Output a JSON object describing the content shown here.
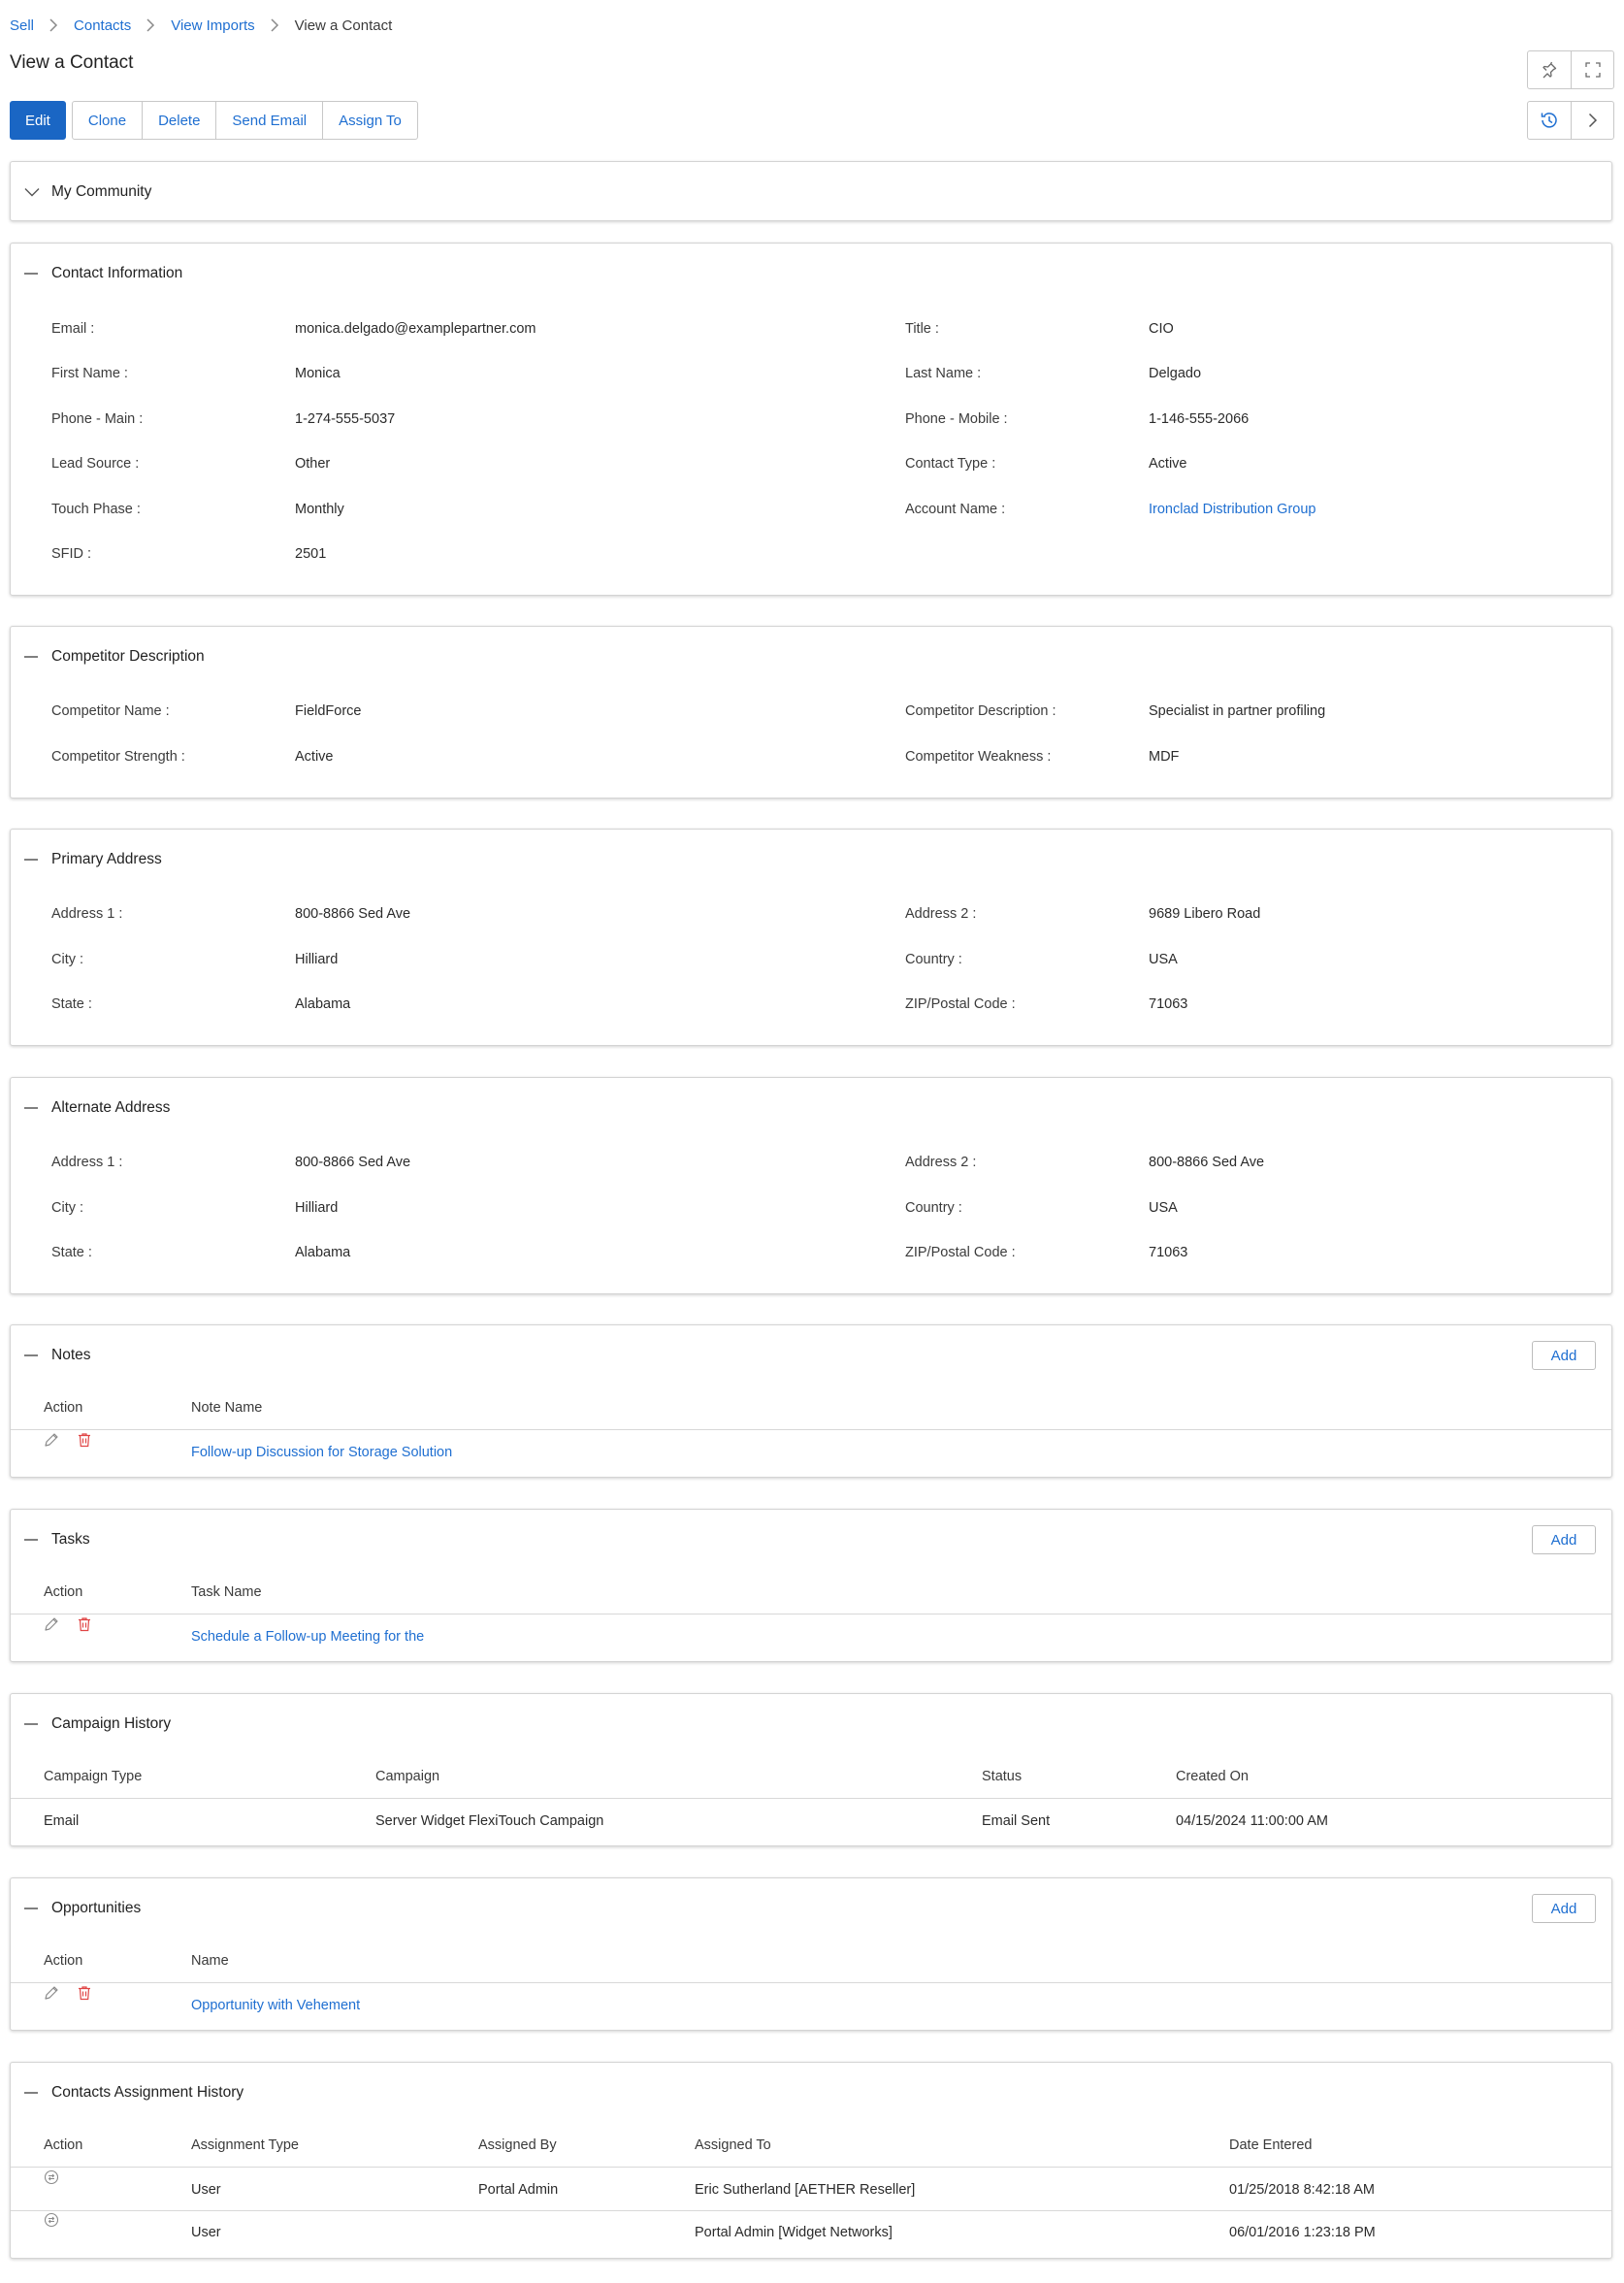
{
  "breadcrumb": {
    "items": [
      "Sell",
      "Contacts",
      "View Imports"
    ],
    "current": "View a Contact"
  },
  "page": {
    "title": "View a Contact"
  },
  "toolbar": {
    "edit": "Edit",
    "clone": "Clone",
    "delete": "Delete",
    "send_email": "Send Email",
    "assign_to": "Assign To"
  },
  "icons": {
    "pin": "pin-icon",
    "expand": "expand-icon",
    "history": "history-icon",
    "next": "chevron-right-icon"
  },
  "colors": {
    "accent": "#1a66c4",
    "link": "#1f6fd1",
    "delete": "#e04545"
  },
  "community": {
    "title": "My Community"
  },
  "contact": {
    "title": "Contact Information",
    "email_label": "Email :",
    "email": "monica.delgado@examplepartner.com",
    "job_title_label": "Title :",
    "job_title": "CIO",
    "first_name_label": "First Name :",
    "first_name": "Monica",
    "last_name_label": "Last Name :",
    "last_name": "Delgado",
    "phone_main_label": "Phone - Main :",
    "phone_main": "1-274-555-5037",
    "phone_mobile_label": "Phone - Mobile :",
    "phone_mobile": "1-146-555-2066",
    "lead_source_label": "Lead Source :",
    "lead_source": "Other",
    "contact_type_label": "Contact Type :",
    "contact_type": "Active",
    "touch_phase_label": "Touch Phase :",
    "touch_phase": "Monthly",
    "account_name_label": "Account Name :",
    "account_name": "Ironclad Distribution Group",
    "sfid_label": "SFID :",
    "sfid": "2501"
  },
  "competitor": {
    "title": "Competitor Description",
    "name_label": "Competitor Name :",
    "name": "FieldForce",
    "description_label": "Competitor Description :",
    "description": "Specialist in partner profiling",
    "strength_label": "Competitor Strength :",
    "strength": "Active",
    "weakness_label": "Competitor Weakness :",
    "weakness": "MDF"
  },
  "primary_address": {
    "title": "Primary Address",
    "address1_label": "Address 1 :",
    "address1": "800-8866 Sed Ave",
    "address2_label": "Address 2 :",
    "address2": "9689 Libero Road",
    "city_label": "City :",
    "city": "Hilliard",
    "country_label": "Country :",
    "country": "USA",
    "state_label": "State :",
    "state": "Alabama",
    "zip_label": "ZIP/Postal Code :",
    "zip": "71063"
  },
  "alternate_address": {
    "title": "Alternate Address",
    "address1_label": "Address 1 :",
    "address1": "800-8866 Sed Ave",
    "address2_label": "Address 2 :",
    "address2": "800-8866 Sed Ave",
    "city_label": "City :",
    "city": "Hilliard",
    "country_label": "Country :",
    "country": "USA",
    "state_label": "State :",
    "state": "Alabama",
    "zip_label": "ZIP/Postal Code :",
    "zip": "71063"
  },
  "notes": {
    "title": "Notes",
    "add": "Add",
    "columns": [
      "Action",
      "Note Name"
    ],
    "rows": [
      {
        "name": "Follow-up Discussion for Storage Solution"
      }
    ]
  },
  "tasks": {
    "title": "Tasks",
    "add": "Add",
    "columns": [
      "Action",
      "Task Name"
    ],
    "rows": [
      {
        "name": "Schedule a Follow-up Meeting for the"
      }
    ]
  },
  "campaign_history": {
    "title": "Campaign History",
    "columns": [
      "Campaign Type",
      "Campaign",
      "Status",
      "Created On"
    ],
    "rows": [
      {
        "type": "Email",
        "campaign": "Server Widget FlexiTouch Campaign",
        "status": "Email Sent",
        "created_on": "04/15/2024 11:00:00 AM"
      }
    ]
  },
  "opportunities": {
    "title": "Opportunities",
    "add": "Add",
    "columns": [
      "Action",
      "Name"
    ],
    "rows": [
      {
        "name": "Opportunity with Vehement"
      }
    ]
  },
  "assignment_history": {
    "title": "Contacts Assignment History",
    "columns": [
      "Action",
      "Assignment Type",
      "Assigned By",
      "Assigned To",
      "Date Entered"
    ],
    "rows": [
      {
        "type": "User",
        "assigned_by": "Portal Admin",
        "assigned_to": "Eric Sutherland [AETHER Reseller]",
        "date": "01/25/2018 8:42:18 AM"
      },
      {
        "type": "User",
        "assigned_by": "",
        "assigned_to": "Portal Admin [Widget Networks]",
        "date": "06/01/2016 1:23:18 PM"
      }
    ]
  }
}
